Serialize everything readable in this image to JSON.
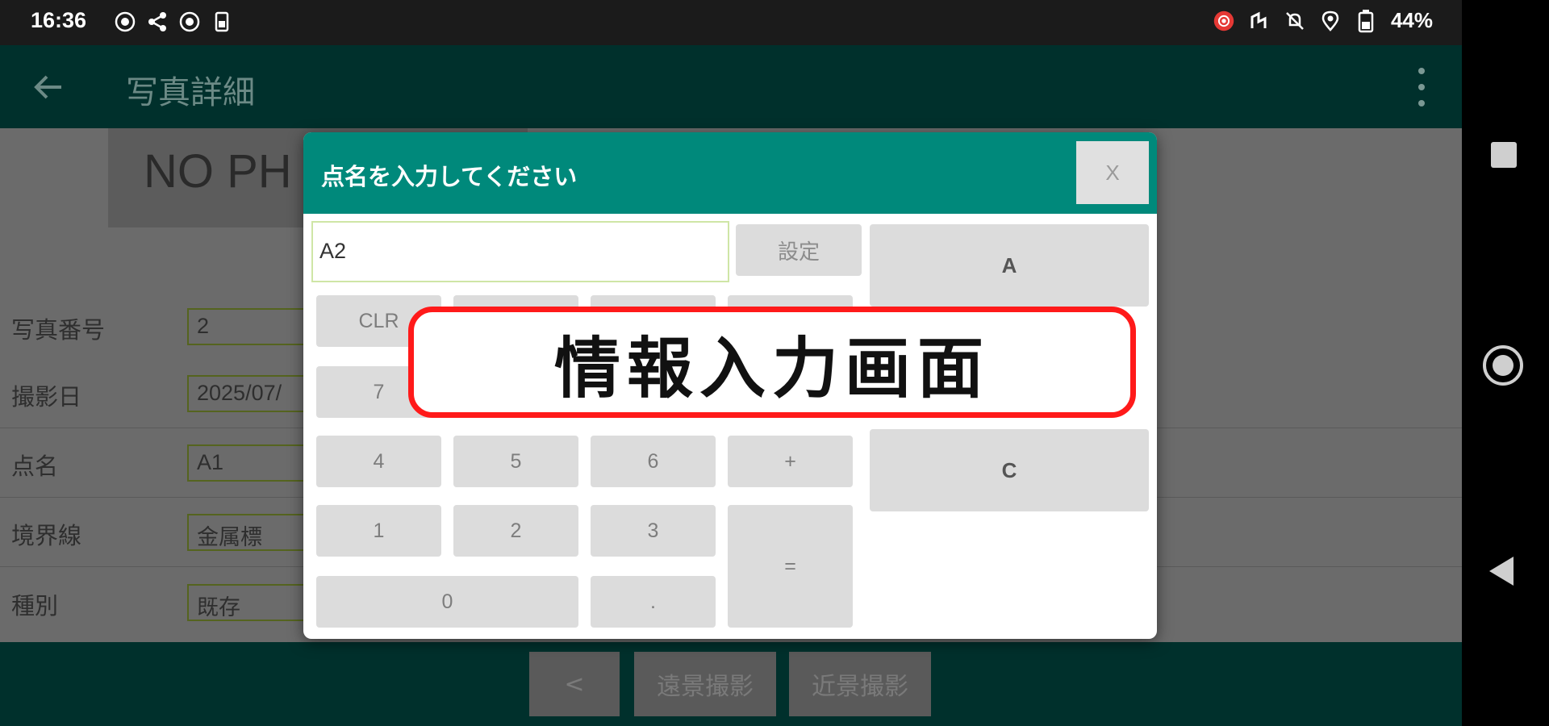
{
  "status_bar": {
    "time": "16:36",
    "battery": "44%"
  },
  "app_bar": {
    "title": "写真詳細"
  },
  "photo": {
    "placeholder": "NO PH"
  },
  "form": {
    "rows": [
      {
        "label": "写真番号",
        "value": "2"
      },
      {
        "label": "撮影日",
        "value": "2025/07/"
      },
      {
        "label": "点名",
        "value": "A1"
      },
      {
        "label": "境界線",
        "value": "金属標"
      },
      {
        "label": "種別",
        "value": "既存"
      }
    ]
  },
  "bottom_bar": {
    "prev_label": "<",
    "far_shot_label": "遠景撮影",
    "near_shot_label": "近景撮影"
  },
  "dialog": {
    "title": "点名を入力してください",
    "close_label": "X",
    "input_value": "A2",
    "set_label": "設定",
    "keys": {
      "clr": "CLR",
      "k7": "7",
      "k4": "4",
      "k5": "5",
      "k6": "6",
      "plus": "+",
      "k1": "1",
      "k2": "2",
      "k3": "3",
      "equals": "=",
      "k0": "0",
      "dot": "."
    },
    "side_keys": {
      "a": "A",
      "c": "C"
    }
  },
  "callout": {
    "text": "情報入力画面"
  },
  "colors": {
    "header_teal": "#00897b",
    "appbar_dim": "#00302c",
    "callout_border": "#ff1a1a"
  }
}
